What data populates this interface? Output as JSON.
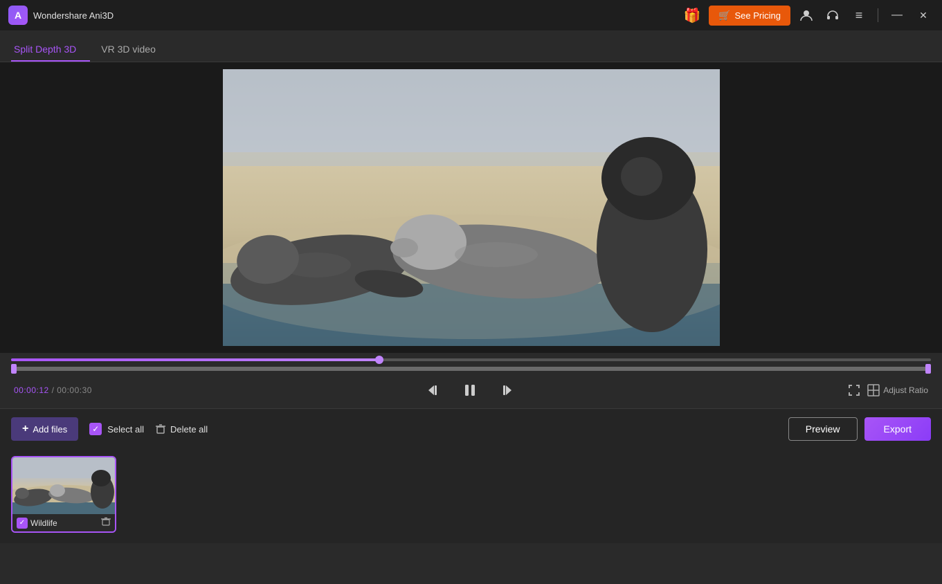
{
  "titlebar": {
    "logo_letter": "A",
    "app_name": "Wondershare Ani3D",
    "gift_icon": "🎁",
    "see_pricing_label": "See Pricing",
    "cart_icon": "🛒",
    "user_icon": "👤",
    "headset_icon": "🎧",
    "menu_icon": "≡",
    "minimize_icon": "—",
    "close_icon": "✕"
  },
  "tabs": [
    {
      "label": "Split Depth 3D",
      "active": true
    },
    {
      "label": "VR 3D video",
      "active": false
    }
  ],
  "controls": {
    "progress_percent": 40,
    "current_time": "00:00:12",
    "total_time": "00:00:30",
    "time_separator": "/",
    "skip_back_icon": "⏮",
    "play_pause_icon": "⏸",
    "skip_forward_icon": "⏭",
    "fullscreen_icon": "⛶",
    "adjust_ratio_icon": "⊞",
    "adjust_ratio_label": "Adjust Ratio"
  },
  "toolbar": {
    "add_files_label": "Add files",
    "add_icon": "+",
    "select_all_label": "Select all",
    "delete_all_label": "Delete all",
    "preview_label": "Preview",
    "export_label": "Export"
  },
  "file_list": [
    {
      "name": "Wildlife",
      "checked": true
    }
  ]
}
